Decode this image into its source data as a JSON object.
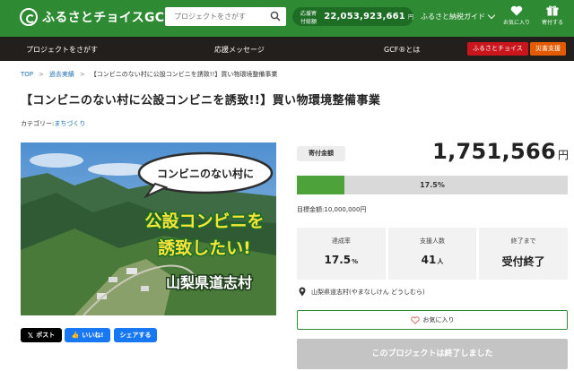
{
  "header": {
    "logo_text": "ふるさとチョイスGCF",
    "search_placeholder": "プロジェクトをさがす",
    "total_label": "応援寄付総額",
    "total_value": "22,053,923,661",
    "total_unit": "円",
    "guide_label": "ふるさと納税ガイド",
    "favorites_label": "お気に入り",
    "donate_label": "寄付する"
  },
  "nav": {
    "items": [
      "プロジェクトをさがす",
      "応援メッセージ",
      "GCF®とは"
    ],
    "tag_choice": "ふるさとチョイス",
    "tag_disaster": "災害支援"
  },
  "breadcrumb": {
    "top": "TOP",
    "past": "過去実績",
    "current": "【コンビニのない村に公設コンビニを誘致!!】買い物環境整備事業"
  },
  "project": {
    "title": "【コンビニのない村に公設コンビニを誘致!!】買い物環境整備事業",
    "category_label": "カテゴリー:",
    "category_value": "まちづくり"
  },
  "hero": {
    "bubble_text": "コンビニのない村に",
    "headline_1": "公設コンビニを",
    "headline_2": "誘致したい!",
    "place": "山梨県道志村"
  },
  "share": {
    "x": "ポスト",
    "like": "いいね!",
    "share": "シェアする"
  },
  "funding": {
    "badge": "寄付金額",
    "amount": "1,751,566",
    "unit": "円",
    "progress_fraction": 0.175,
    "progress_label": "17.5%",
    "goal_label": "目標金額:",
    "goal_value": "10,000,000円"
  },
  "stats": {
    "rate_label": "達成率",
    "rate_value": "17.5",
    "rate_unit": "%",
    "supporters_label": "支援人数",
    "supporters_value": "41",
    "supporters_unit": "人",
    "until_label": "終了まで",
    "until_value": "受付終了"
  },
  "location": "山梨県道志村(やまなしけん どうしむら)",
  "favorite_button": "お気に入り",
  "ended_button": "このプロジェクトは終了しました",
  "colors": {
    "brand_green": "#2e8b33",
    "nav_dark": "#231f1c",
    "progress_green": "#4da33a",
    "link_blue": "#1f6fb2"
  }
}
